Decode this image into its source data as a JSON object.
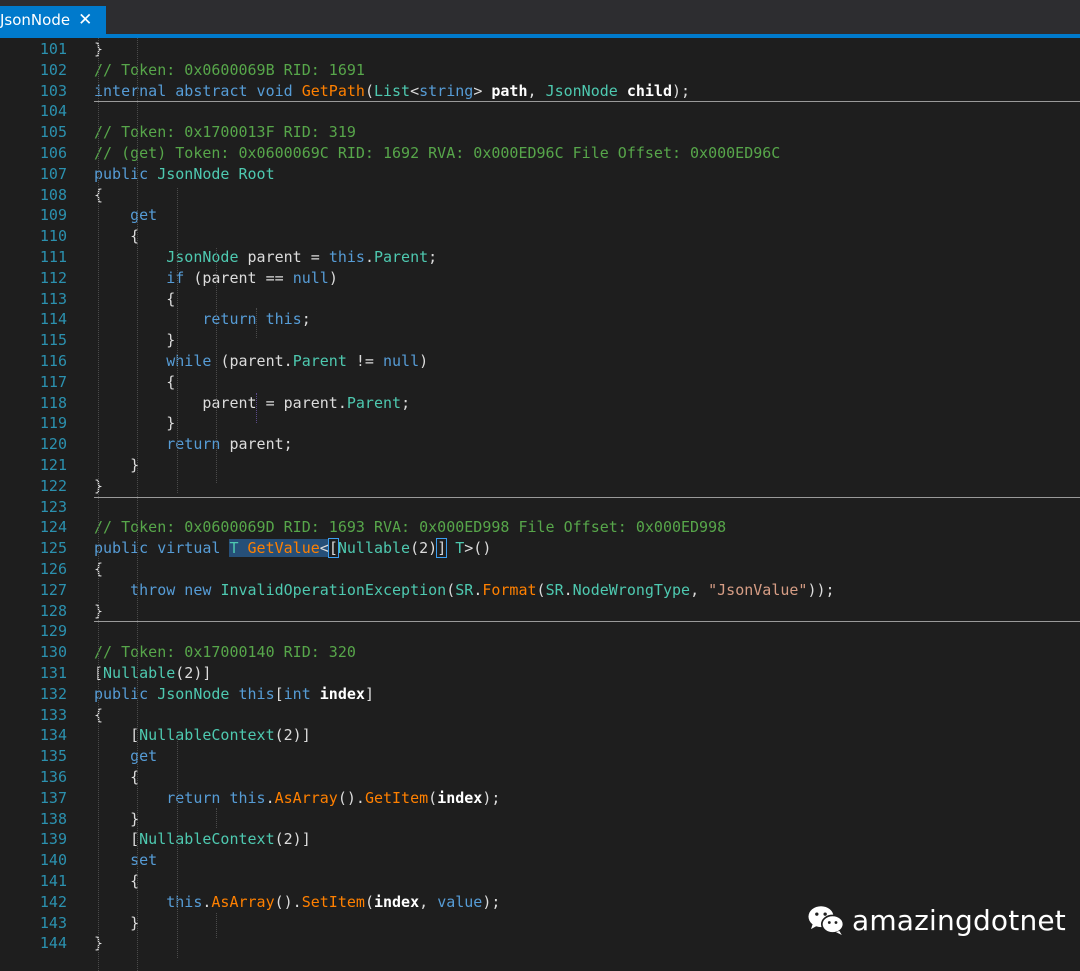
{
  "tab": {
    "title": "JsonNode",
    "close_glyph": "✕"
  },
  "editor": {
    "colors": {
      "keyword": "#569cd6",
      "type": "#4ec9b0",
      "comment": "#57a64a",
      "string": "#d69d85",
      "method": "#ff8000",
      "line_number": "#2b91af",
      "background": "#1e1e1e",
      "accent": "#007acc"
    },
    "line_numbers": [
      "101",
      "102",
      "103",
      "104",
      "105",
      "106",
      "107",
      "108",
      "109",
      "110",
      "111",
      "112",
      "113",
      "114",
      "115",
      "116",
      "117",
      "118",
      "119",
      "120",
      "121",
      "122",
      "123",
      "124",
      "125",
      "126",
      "127",
      "128",
      "129",
      "130",
      "131",
      "132",
      "133",
      "134",
      "135",
      "136",
      "137",
      "138",
      "139",
      "140",
      "141",
      "142",
      "143",
      "144"
    ],
    "lines": [
      [
        {
          "t": "}"
        }
      ],
      [
        {
          "t": "// Token: 0x0600069B RID: 1691",
          "c": "c"
        }
      ],
      [
        {
          "t": "internal abstract void ",
          "c": "k"
        },
        {
          "t": "GetPath",
          "c": "m"
        },
        {
          "t": "("
        },
        {
          "t": "List",
          "c": "t"
        },
        {
          "t": "<"
        },
        {
          "t": "string",
          "c": "k"
        },
        {
          "t": "> "
        },
        {
          "t": "path",
          "c": "b"
        },
        {
          "t": ", "
        },
        {
          "t": "JsonNode ",
          "c": "t"
        },
        {
          "t": "child",
          "c": "b"
        },
        {
          "t": ");"
        }
      ],
      [],
      [
        {
          "t": "// Token: 0x1700013F RID: 319",
          "c": "c"
        }
      ],
      [
        {
          "t": "// (get) Token: 0x0600069C RID: 1692 RVA: 0x000ED96C File Offset: 0x000ED96C",
          "c": "c"
        }
      ],
      [
        {
          "t": "public ",
          "c": "k"
        },
        {
          "t": "JsonNode ",
          "c": "t"
        },
        {
          "t": "Root",
          "c": "p"
        }
      ],
      [
        {
          "t": "{"
        }
      ],
      [
        {
          "t": "    get",
          "c": "k"
        }
      ],
      [
        {
          "t": "    {"
        }
      ],
      [
        {
          "t": "        "
        },
        {
          "t": "JsonNode ",
          "c": "t"
        },
        {
          "t": "parent = "
        },
        {
          "t": "this",
          "c": "k"
        },
        {
          "t": "."
        },
        {
          "t": "Parent",
          "c": "p"
        },
        {
          "t": ";"
        }
      ],
      [
        {
          "t": "        "
        },
        {
          "t": "if ",
          "c": "k"
        },
        {
          "t": "(parent == "
        },
        {
          "t": "null",
          "c": "k"
        },
        {
          "t": ")"
        }
      ],
      [
        {
          "t": "        {"
        }
      ],
      [
        {
          "t": "            "
        },
        {
          "t": "return this",
          "c": "k"
        },
        {
          "t": ";"
        }
      ],
      [
        {
          "t": "        }"
        }
      ],
      [
        {
          "t": "        "
        },
        {
          "t": "while ",
          "c": "k"
        },
        {
          "t": "(parent."
        },
        {
          "t": "Parent",
          "c": "p"
        },
        {
          "t": " != "
        },
        {
          "t": "null",
          "c": "k"
        },
        {
          "t": ")"
        }
      ],
      [
        {
          "t": "        {"
        }
      ],
      [
        {
          "t": "            parent = parent."
        },
        {
          "t": "Parent",
          "c": "p"
        },
        {
          "t": ";"
        }
      ],
      [
        {
          "t": "        }"
        }
      ],
      [
        {
          "t": "        "
        },
        {
          "t": "return ",
          "c": "k"
        },
        {
          "t": "parent;"
        }
      ],
      [
        {
          "t": "    }"
        }
      ],
      [
        {
          "t": "}"
        }
      ],
      [],
      [
        {
          "t": "// Token: 0x0600069D RID: 1693 RVA: 0x000ED998 File Offset: 0x000ED998",
          "c": "c"
        }
      ],
      [
        {
          "t": "public virtual ",
          "c": "k"
        },
        {
          "t": "T",
          "c": "t h"
        },
        {
          "t": " ",
          "c": "h"
        },
        {
          "t": "GetValue",
          "c": "m h"
        },
        {
          "t": "<",
          "c": "h"
        },
        {
          "t": "[",
          "c": "brk"
        },
        {
          "t": "Nullable",
          "c": "t"
        },
        {
          "t": "(2)"
        },
        {
          "t": "]",
          "c": "brk"
        },
        {
          "t": " "
        },
        {
          "t": "T",
          "c": "t"
        },
        {
          "t": ">()"
        }
      ],
      [
        {
          "t": "{"
        }
      ],
      [
        {
          "t": "    "
        },
        {
          "t": "throw new ",
          "c": "k"
        },
        {
          "t": "InvalidOperationException",
          "c": "t"
        },
        {
          "t": "("
        },
        {
          "t": "SR",
          "c": "t"
        },
        {
          "t": "."
        },
        {
          "t": "Format",
          "c": "m"
        },
        {
          "t": "("
        },
        {
          "t": "SR",
          "c": "t"
        },
        {
          "t": "."
        },
        {
          "t": "NodeWrongType",
          "c": "p"
        },
        {
          "t": ", "
        },
        {
          "t": "\"JsonValue\"",
          "c": "s"
        },
        {
          "t": "));"
        }
      ],
      [
        {
          "t": "}"
        }
      ],
      [],
      [
        {
          "t": "// Token: 0x17000140 RID: 320",
          "c": "c"
        }
      ],
      [
        {
          "t": "["
        },
        {
          "t": "Nullable",
          "c": "t"
        },
        {
          "t": "(2)]"
        }
      ],
      [
        {
          "t": "public ",
          "c": "k"
        },
        {
          "t": "JsonNode ",
          "c": "t"
        },
        {
          "t": "this",
          "c": "k"
        },
        {
          "t": "["
        },
        {
          "t": "int ",
          "c": "k"
        },
        {
          "t": "index",
          "c": "b"
        },
        {
          "t": "]"
        }
      ],
      [
        {
          "t": "{"
        }
      ],
      [
        {
          "t": "    ["
        },
        {
          "t": "NullableContext",
          "c": "t"
        },
        {
          "t": "(2)]"
        }
      ],
      [
        {
          "t": "    get",
          "c": "k"
        }
      ],
      [
        {
          "t": "    {"
        }
      ],
      [
        {
          "t": "        "
        },
        {
          "t": "return this",
          "c": "k"
        },
        {
          "t": "."
        },
        {
          "t": "AsArray",
          "c": "m"
        },
        {
          "t": "()."
        },
        {
          "t": "GetItem",
          "c": "m"
        },
        {
          "t": "("
        },
        {
          "t": "index",
          "c": "b"
        },
        {
          "t": ");"
        }
      ],
      [
        {
          "t": "    }"
        }
      ],
      [
        {
          "t": "    ["
        },
        {
          "t": "NullableContext",
          "c": "t"
        },
        {
          "t": "(2)]"
        }
      ],
      [
        {
          "t": "    set",
          "c": "k"
        }
      ],
      [
        {
          "t": "    {"
        }
      ],
      [
        {
          "t": "        "
        },
        {
          "t": "this",
          "c": "k"
        },
        {
          "t": "."
        },
        {
          "t": "AsArray",
          "c": "m"
        },
        {
          "t": "()."
        },
        {
          "t": "SetItem",
          "c": "m"
        },
        {
          "t": "("
        },
        {
          "t": "index",
          "c": "b"
        },
        {
          "t": ", "
        },
        {
          "t": "value",
          "c": "k"
        },
        {
          "t": ");"
        }
      ],
      [
        {
          "t": "    }"
        }
      ],
      [
        {
          "t": "}"
        }
      ]
    ],
    "separators_after": [
      "103",
      "122",
      "128"
    ]
  },
  "watermark": {
    "text": "amazingdotnet",
    "icon": "wechat-icon"
  }
}
